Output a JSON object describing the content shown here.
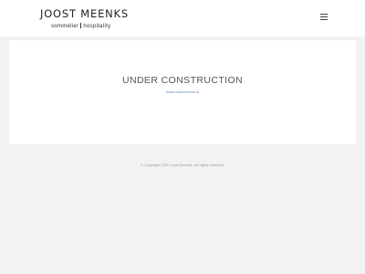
{
  "header": {
    "logo_name": "JOOST MEENKS",
    "tagline_left": "sommelier",
    "tagline_right": "hospitality",
    "menu_icon": "hamburger-menu-icon"
  },
  "main": {
    "title": "UNDER CONSTRUCTION",
    "link_text": "www.hollemeenks.nl"
  },
  "footer": {
    "copyright": "© Copyright 2020 Joost Meenks. All rights reserved."
  }
}
